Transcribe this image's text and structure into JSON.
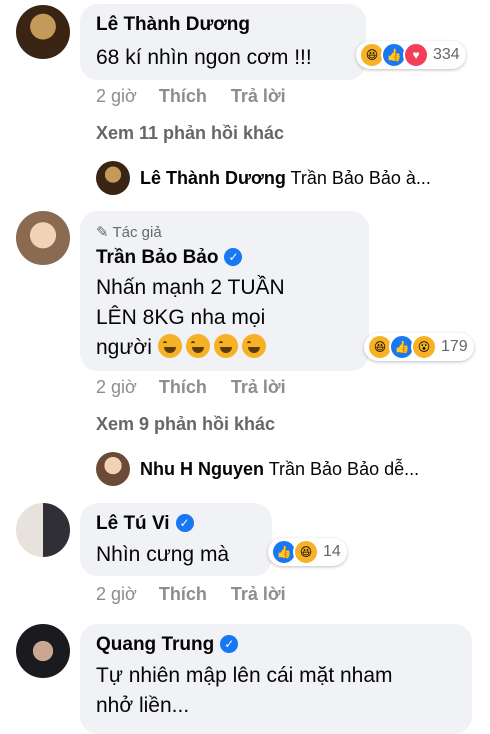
{
  "comments": [
    {
      "author": "Lê Thành Dương",
      "text_lines": [
        "68 kí nhìn ngon cơm !!!"
      ],
      "reaction_count": "334",
      "reactions": [
        "haha-icon",
        "like-icon",
        "love-icon"
      ],
      "time": "2 giờ",
      "like_label": "Thích",
      "reply_label": "Trả lời",
      "more_replies": "Xem 11 phản hồi khác",
      "reply_preview": {
        "author": "Lê Thành Dương",
        "text": "Trần Bảo Bảo à..."
      }
    },
    {
      "badge": "Tác giả",
      "author": "Trần Bảo Bảo",
      "verified": true,
      "text_lines": [
        "Nhấn mạnh 2 TUẦN",
        "LÊN 8KG nha mọi",
        "người"
      ],
      "reaction_count": "179",
      "reactions": [
        "haha-icon",
        "like-icon",
        "wow-icon"
      ],
      "time": "2 giờ",
      "like_label": "Thích",
      "reply_label": "Trả lời",
      "more_replies": "Xem 9 phản hồi khác",
      "reply_preview": {
        "author": "Nhu H Nguyen",
        "text": "Trần Bảo Bảo dễ..."
      }
    },
    {
      "author": "Lê Tú Vi",
      "verified": true,
      "text_lines": [
        "Nhìn cưng mà"
      ],
      "reaction_count": "14",
      "reactions": [
        "like-icon",
        "haha-icon"
      ],
      "time": "2 giờ",
      "like_label": "Thích",
      "reply_label": "Trả lời"
    },
    {
      "author": "Quang Trung",
      "verified": true,
      "text_lines": [
        "Tự nhiên mập lên cái mặt nham",
        "nhở liền..."
      ]
    }
  ],
  "colors": {
    "bubble": "#f0f2f5",
    "meta": "#8a8d91",
    "verified": "#1877f2"
  }
}
